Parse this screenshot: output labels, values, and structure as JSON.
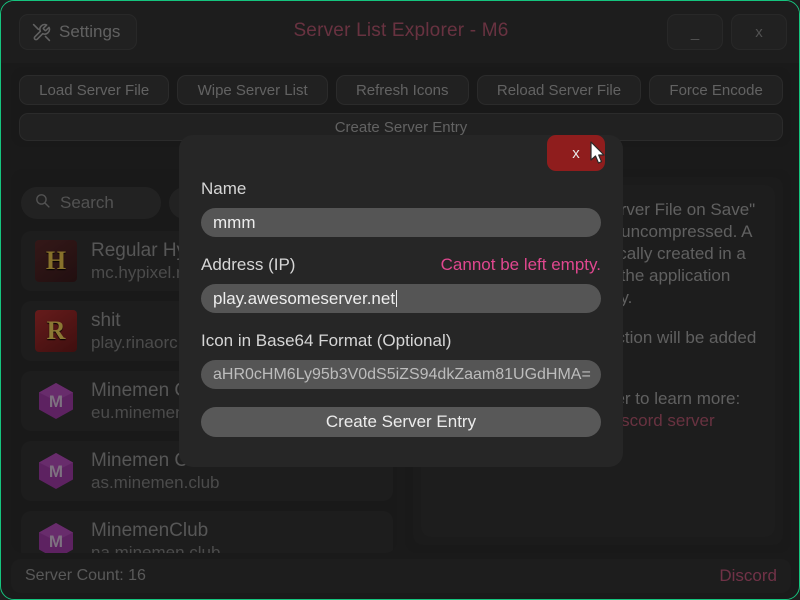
{
  "titlebar": {
    "settings_label": "Settings",
    "settings_icon": "tools-icon",
    "title": "Server List Explorer - M6",
    "minimize_label": "_",
    "close_label": "x",
    "title_color": "#b4566f"
  },
  "toolbar": {
    "buttons": [
      {
        "label": "Load Server File"
      },
      {
        "label": "Wipe Server List"
      },
      {
        "label": "Refresh Icons"
      },
      {
        "label": "Reload Server File"
      },
      {
        "label": "Force Encode"
      }
    ],
    "create_entry_label": "Create Server Entry"
  },
  "left_panel": {
    "search_placeholder": "Search",
    "search_icon": "search-icon",
    "servers": [
      {
        "name": "Regular Hypixel",
        "address": "mc.hypixel.net",
        "icon": "hypixel",
        "glyph": "H"
      },
      {
        "name": "shit",
        "address": "play.rinaorc.com",
        "icon": "rinaorc",
        "glyph": "R"
      },
      {
        "name": "Minemen Club EU",
        "address": "eu.minemen.club",
        "icon": "minemen",
        "glyph": "M"
      },
      {
        "name": "Minemen Club AS",
        "address": "as.minemen.club",
        "icon": "minemen",
        "glyph": "M"
      },
      {
        "name": "MinemenClub",
        "address": "na.minemen.club",
        "icon": "minemen",
        "glyph": "M"
      }
    ]
  },
  "right_panel": {
    "paragraph_1": "Enabling \"Compress Server File on Save\" will store the server file uncompressed. A backup file is automatically created in a backup folder within the application directory.",
    "paragraph_2": "More options for this section will be added soon.",
    "discord_label": "Join our Discord server to learn more:",
    "discord_link": "Hyperlink to our Discord server"
  },
  "statusbar": {
    "server_count": "Server Count: 16",
    "discord_label": "Discord"
  },
  "modal": {
    "close_label": "x",
    "name_label": "Name",
    "name_value": "mmm",
    "address_label": "Address (IP)",
    "address_error": "Cannot be left empty.",
    "address_value": "play.awesomeserver.net",
    "icon_label": "Icon in Base64 Format (Optional)",
    "icon_value": "aHR0cHM6Ly95b3V0dS5iZS94dkZaam81UGdHMA=",
    "submit_label": "Create Server Entry",
    "error_color": "#e0478f",
    "close_color": "#8f1d1d"
  }
}
